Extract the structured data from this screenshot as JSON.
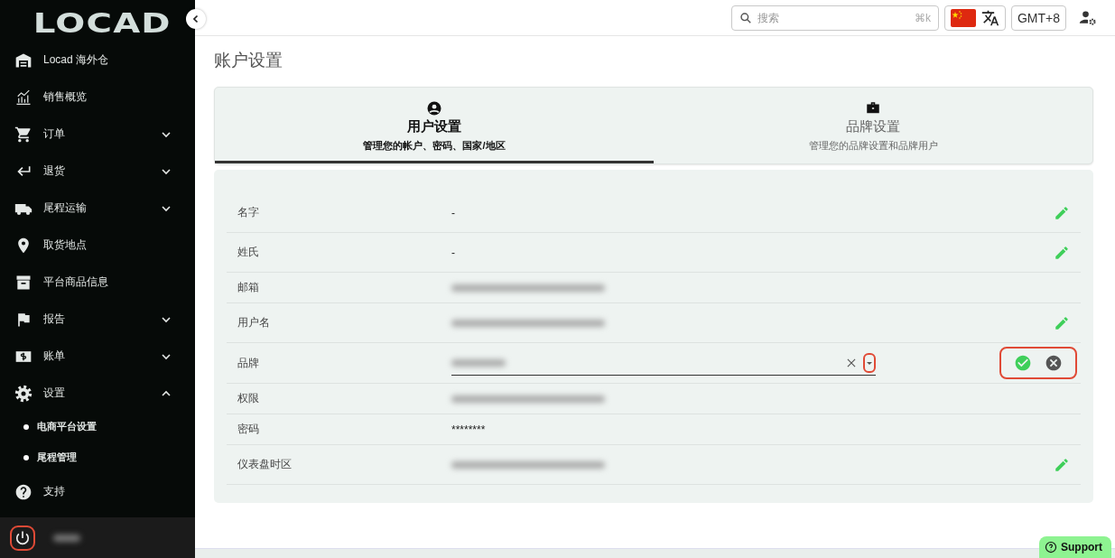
{
  "sidebar": {
    "logo": "LOCAD",
    "items": [
      {
        "label": "Locad 海外仓"
      },
      {
        "label": "销售概览"
      },
      {
        "label": "订单",
        "expanded": false
      },
      {
        "label": "退货",
        "expanded": false
      },
      {
        "label": "尾程运输",
        "expanded": false
      },
      {
        "label": "取货地点"
      },
      {
        "label": "平台商品信息"
      },
      {
        "label": "报告",
        "expanded": false
      },
      {
        "label": "账单",
        "expanded": false
      },
      {
        "label": "设置",
        "expanded": true,
        "children": [
          {
            "label": "电商平台设置"
          },
          {
            "label": "尾程管理"
          }
        ]
      },
      {
        "label": "支持"
      }
    ],
    "power_highlighted": true
  },
  "top_bar": {
    "search": {
      "placeholder": "搜索",
      "shortcut": "⌘k"
    },
    "timezone": "GMT+8"
  },
  "page_title": "账户设置",
  "tabs": [
    {
      "title": "用户设置",
      "subtitle": "管理您的帐户、密码、国家/地区",
      "selected": true
    },
    {
      "title": "品牌设置",
      "subtitle": "管理您的品牌设置和品牌用户",
      "selected": false
    }
  ],
  "rows": [
    {
      "label": "名字",
      "kind": "text",
      "value": "-",
      "editable": true
    },
    {
      "label": "姓氏",
      "kind": "text",
      "value": "-",
      "editable": true
    },
    {
      "label": "邮箱",
      "kind": "redacted",
      "editable": false
    },
    {
      "label": "用户名",
      "kind": "redacted",
      "editable": true
    },
    {
      "label": "品牌",
      "kind": "select",
      "caret_highlighted": true,
      "actions_highlighted": true
    },
    {
      "label": "权限",
      "kind": "redacted",
      "editable": false
    },
    {
      "label": "密码",
      "kind": "text",
      "value": "********",
      "editable": false
    },
    {
      "label": "仪表盘时区",
      "kind": "redacted",
      "editable": true
    }
  ],
  "support_button": "Support"
}
